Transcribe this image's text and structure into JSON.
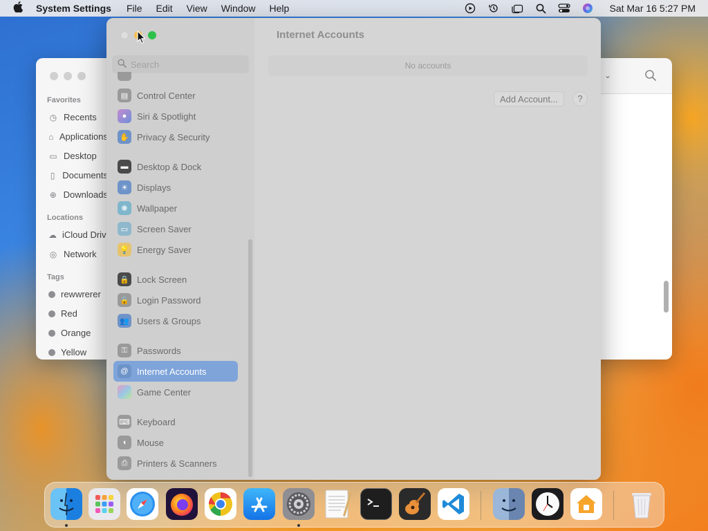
{
  "menubar": {
    "app_name": "System Settings",
    "menus": [
      "File",
      "Edit",
      "View",
      "Window",
      "Help"
    ],
    "status_icons": [
      "screen-record-icon",
      "time-machine-icon",
      "stage-manager-icon",
      "spotlight-search-icon",
      "control-center-icon",
      "siri-icon"
    ],
    "clock": "Sat Mar 16  5:27 PM"
  },
  "finder": {
    "favorites_header": "Favorites",
    "favorites": [
      {
        "label": "Recents",
        "icon": "clock-icon"
      },
      {
        "label": "Applications",
        "icon": "applications-icon"
      },
      {
        "label": "Desktop",
        "icon": "desktop-icon"
      },
      {
        "label": "Documents",
        "icon": "document-icon"
      },
      {
        "label": "Downloads",
        "icon": "download-icon"
      }
    ],
    "locations_header": "Locations",
    "locations": [
      {
        "label": "iCloud Drive",
        "icon": "cloud-icon"
      },
      {
        "label": "Network",
        "icon": "network-icon"
      }
    ],
    "tags_header": "Tags",
    "tags": [
      {
        "label": "rewwrerer",
        "color": "#8e8e93"
      },
      {
        "label": "Red",
        "color": "#8e8e93"
      },
      {
        "label": "Orange",
        "color": "#8e8e93"
      },
      {
        "label": "Yellow",
        "color": "#8e8e93"
      }
    ]
  },
  "settings": {
    "window_title": "Internet Accounts",
    "search_placeholder": "Search",
    "nav": [
      {
        "label": "Control Center",
        "icon": "control-center-icon",
        "color": "#9a9a9a"
      },
      {
        "label": "Siri & Spotlight",
        "icon": "siri-icon",
        "color": "#8b6fb0"
      },
      {
        "label": "Privacy & Security",
        "icon": "hand-icon",
        "color": "#6e93c9"
      },
      {
        "label": "Desktop & Dock",
        "icon": "dock-icon",
        "color": "#4a4a4a"
      },
      {
        "label": "Displays",
        "icon": "sun-icon",
        "color": "#6e93c9"
      },
      {
        "label": "Wallpaper",
        "icon": "wallpaper-icon",
        "color": "#7fb6cc"
      },
      {
        "label": "Screen Saver",
        "icon": "screen-saver-icon",
        "color": "#8fb8cc"
      },
      {
        "label": "Energy Saver",
        "icon": "bulb-icon",
        "color": "#e7c46b"
      },
      {
        "label": "Lock Screen",
        "icon": "lock-icon",
        "color": "#4a4a4a"
      },
      {
        "label": "Login Password",
        "icon": "lock-icon",
        "color": "#9a9a9a"
      },
      {
        "label": "Users & Groups",
        "icon": "users-icon",
        "color": "#6e93c9"
      },
      {
        "label": "Passwords",
        "icon": "key-icon",
        "color": "#9a9a9a"
      },
      {
        "label": "Internet Accounts",
        "icon": "at-icon",
        "color": "#6e93c9",
        "selected": true
      },
      {
        "label": "Game Center",
        "icon": "game-center-icon",
        "color": "#c98fb0"
      },
      {
        "label": "Keyboard",
        "icon": "keyboard-icon",
        "color": "#9a9a9a"
      },
      {
        "label": "Mouse",
        "icon": "mouse-icon",
        "color": "#9a9a9a"
      },
      {
        "label": "Printers & Scanners",
        "icon": "printer-icon",
        "color": "#9a9a9a"
      }
    ],
    "no_accounts": "No accounts",
    "add_account_label": "Add Account...",
    "help_label": "?"
  },
  "dock": {
    "apps": [
      {
        "name": "Finder",
        "icon": "finder-icon",
        "running": true
      },
      {
        "name": "Launchpad",
        "icon": "launchpad-icon",
        "running": false
      },
      {
        "name": "Safari",
        "icon": "safari-icon",
        "running": false
      },
      {
        "name": "Firefox",
        "icon": "firefox-icon",
        "running": false
      },
      {
        "name": "Chrome",
        "icon": "chrome-icon",
        "running": false
      },
      {
        "name": "App Store",
        "icon": "app-store-icon",
        "running": false
      },
      {
        "name": "System Settings",
        "icon": "system-settings-icon",
        "running": true
      },
      {
        "name": "TextEdit",
        "icon": "textedit-icon",
        "running": false
      },
      {
        "name": "Terminal",
        "icon": "terminal-icon",
        "running": false
      },
      {
        "name": "GarageBand",
        "icon": "garageband-icon",
        "running": false
      },
      {
        "name": "Visual Studio Code",
        "icon": "vscode-icon",
        "running": false
      },
      {
        "name": "Finder Copy",
        "icon": "finder-icon",
        "running": false
      },
      {
        "name": "Clock",
        "icon": "clock-icon",
        "running": false
      },
      {
        "name": "Home",
        "icon": "home-icon",
        "running": false
      },
      {
        "name": "Trash",
        "icon": "trash-icon",
        "running": false
      }
    ]
  }
}
